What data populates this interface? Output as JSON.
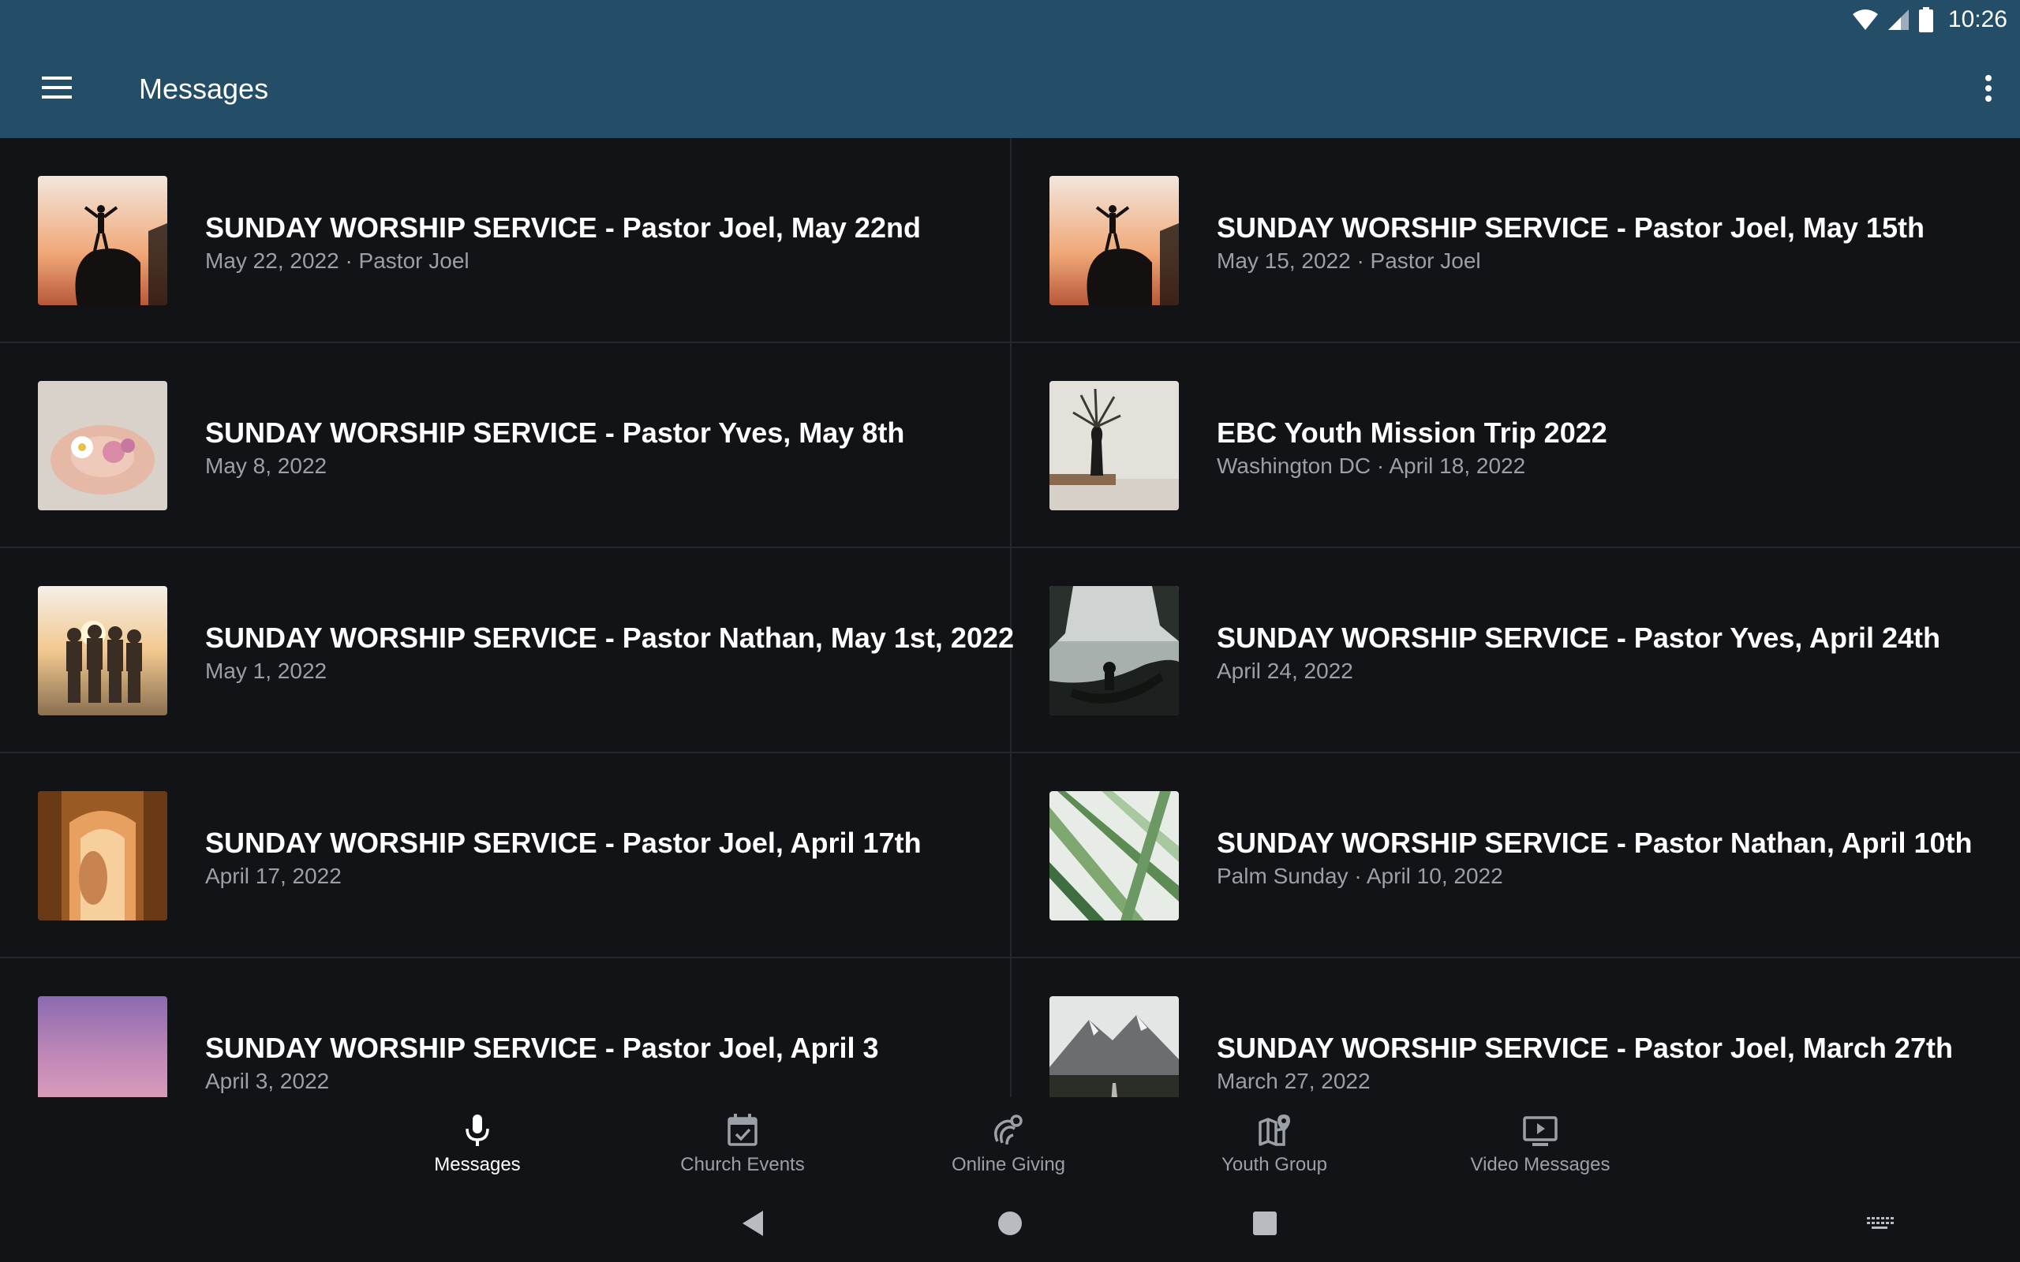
{
  "status_bar": {
    "time": "10:26",
    "icons": [
      "wifi-icon",
      "cellular-signal-icon",
      "battery-icon"
    ]
  },
  "app_bar": {
    "title": "Messages",
    "menu_icon": "hamburger-menu-icon",
    "overflow_icon": "more-vert-icon",
    "background": "#244d68"
  },
  "messages": [
    {
      "title": "SUNDAY WORSHIP SERVICE - Pastor Joel, May 22nd",
      "subtitle": "May 22, 2022 · Pastor Joel",
      "thumbnail": "silhouette-on-rock-sunset"
    },
    {
      "title": "SUNDAY WORSHIP SERVICE - Pastor Joel, May 15th",
      "subtitle": "May 15, 2022 · Pastor Joel",
      "thumbnail": "silhouette-on-rock-sunset"
    },
    {
      "title": "SUNDAY WORSHIP SERVICE - Pastor Yves, May 8th",
      "subtitle": "May 8, 2022",
      "thumbnail": "hands-holding-flowers"
    },
    {
      "title": "EBC Youth Mission Trip 2022",
      "subtitle": "Washington DC · April 18, 2022",
      "thumbnail": "vase-with-plant"
    },
    {
      "title": "SUNDAY WORSHIP SERVICE - Pastor Nathan, May 1st, 2022",
      "subtitle": "May 1, 2022",
      "thumbnail": "friends-at-sunset"
    },
    {
      "title": "SUNDAY WORSHIP SERVICE - Pastor Yves, April 24th",
      "subtitle": "April 24, 2022",
      "thumbnail": "person-in-hammock"
    },
    {
      "title": "SUNDAY WORSHIP SERVICE - Pastor Joel, April 17th",
      "subtitle": "April 17, 2022",
      "thumbnail": "empty-tomb"
    },
    {
      "title": "SUNDAY WORSHIP SERVICE - Pastor Nathan, April 10th",
      "subtitle": "Palm Sunday · April 10, 2022",
      "thumbnail": "palm-leaves"
    },
    {
      "title": "SUNDAY WORSHIP SERVICE - Pastor Joel, April 3",
      "subtitle": "April 3, 2022",
      "thumbnail": "pink-sky"
    },
    {
      "title": "SUNDAY WORSHIP SERVICE - Pastor Joel, March 27th",
      "subtitle": "March 27, 2022",
      "thumbnail": "mountain-road"
    }
  ],
  "bottom_nav": [
    {
      "label": "Messages",
      "icon": "microphone-icon",
      "active": true
    },
    {
      "label": "Church Events",
      "icon": "calendar-check-icon",
      "active": false
    },
    {
      "label": "Online Giving",
      "icon": "giving-hand-icon",
      "active": false
    },
    {
      "label": "Youth Group",
      "icon": "map-pin-icon",
      "active": false
    },
    {
      "label": "Video Messages",
      "icon": "video-screen-icon",
      "active": false
    }
  ],
  "system_nav": [
    "back-icon",
    "home-icon",
    "recents-icon",
    "keyboard-icon"
  ]
}
